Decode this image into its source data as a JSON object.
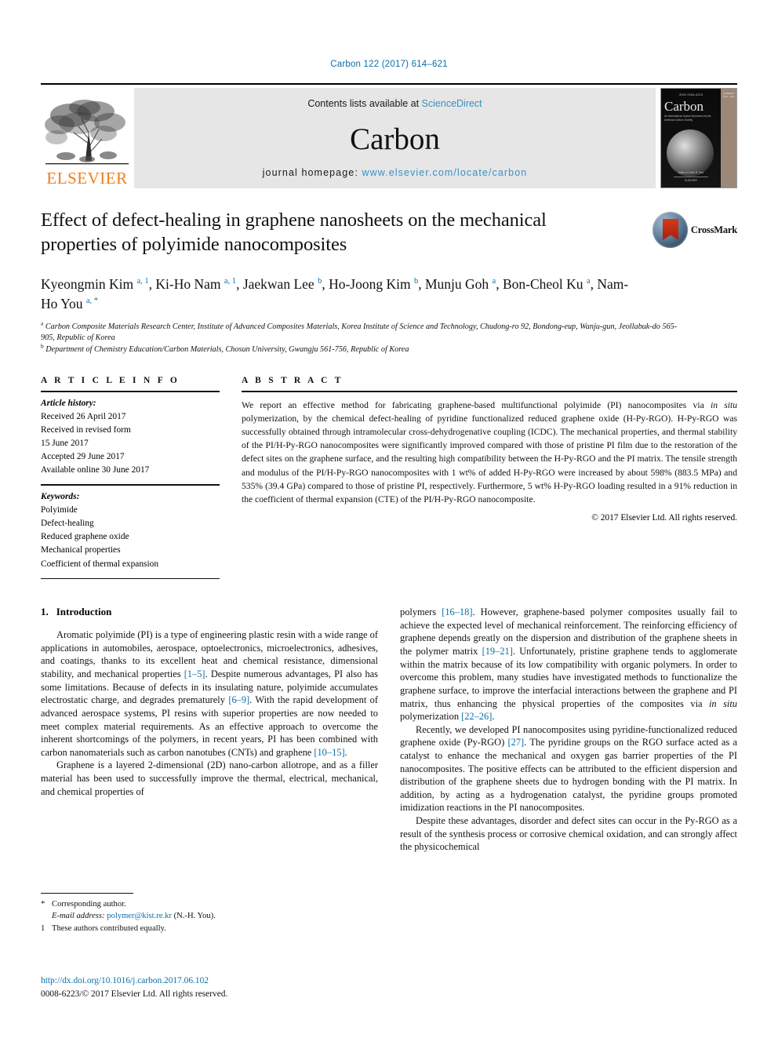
{
  "running_head": "Carbon 122 (2017) 614–621",
  "header": {
    "publisher_name": "ELSEVIER",
    "contents_prefix": "Contents lists available at ",
    "contents_link": "ScienceDirect",
    "journal_title": "Carbon",
    "homepage_prefix": "journal homepage: ",
    "homepage_url": "www.elsevier.com/locate/carbon",
    "cover": {
      "top_label": "ISSN 0008-6223",
      "word": "Carbon",
      "subtitle": "An International Journal Sponsored by the American Carbon Society",
      "spine_label": "CARBON  VOL. 122",
      "bottom_line1": "Editor-in-Chief: R. Hurt",
      "bottom_line2": "ELSEVIER"
    }
  },
  "article": {
    "title": "Effect of defect-healing in graphene nanosheets on the mechanical properties of polyimide nanocomposites",
    "crossmark_label": "CrossMark",
    "authors": [
      {
        "name": "Kyeongmin Kim",
        "sup": "a, 1",
        "sep": ", "
      },
      {
        "name": "Ki-Ho Nam",
        "sup": "a, 1",
        "sep": ", "
      },
      {
        "name": "Jaekwan Lee",
        "sup": "b",
        "sep": ", "
      },
      {
        "name": "Ho-Joong Kim",
        "sup": "b",
        "sep": ", "
      },
      {
        "name": "Munju Goh",
        "sup": "a",
        "sep": ", "
      },
      {
        "name": "Bon-Cheol Ku",
        "sup": "a",
        "sep": ", "
      },
      {
        "name": "Nam-Ho You",
        "sup": "a, *",
        "sep": ""
      }
    ],
    "affiliations": [
      {
        "mark": "a",
        "text": "Carbon Composite Materials Research Center, Institute of Advanced Composites Materials, Korea Institute of Science and Technology, Chudong-ro 92, Bondong-eup, Wanju-gun, Jeollabuk-do 565-905, Republic of Korea"
      },
      {
        "mark": "b",
        "text": "Department of Chemistry Education/Carbon Materials, Chosun University, Gwangju 561-756, Republic of Korea"
      }
    ]
  },
  "article_info": {
    "heading": "A R T I C L E  I N F O",
    "history_label": "Article history:",
    "history": [
      "Received 26 April 2017",
      "Received in revised form",
      "15 June 2017",
      "Accepted 29 June 2017",
      "Available online 30 June 2017"
    ],
    "keywords_label": "Keywords:",
    "keywords": [
      "Polyimide",
      "Defect-healing",
      "Reduced graphene oxide",
      "Mechanical properties",
      "Coefficient of thermal expansion"
    ]
  },
  "abstract": {
    "heading": "A B S T R A C T",
    "part1": "We report an effective method for fabricating graphene-based multifunctional polyimide (PI) nanocomposites via ",
    "italic1": "in situ",
    "part2": " polymerization, by the chemical defect-healing of pyridine functionalized reduced graphene oxide (H-Py-RGO). H-Py-RGO was successfully obtained through intramolecular cross-dehydrogenative coupling (ICDC). The mechanical properties, and thermal stability of the PI/H-Py-RGO nanocomposites were significantly improved compared with those of pristine PI film due to the restoration of the defect sites on the graphene surface, and the resulting high compatibility between the H-Py-RGO and the PI matrix. The tensile strength and modulus of the PI/H-Py-RGO nanocomposites with 1 wt% of added H-Py-RGO were increased by about 598% (883.5 MPa) and 535% (39.4 GPa) compared to those of pristine PI, respectively. Furthermore, 5 wt% H-Py-RGO loading resulted in a 91% reduction in the coefficient of thermal expansion (CTE) of the PI/H-Py-RGO nanocomposite.",
    "copyright": "© 2017 Elsevier Ltd. All rights reserved."
  },
  "intro": {
    "number": "1.",
    "heading": "Introduction",
    "left": {
      "p1_a": "Aromatic polyimide (PI) is a type of engineering plastic resin with a wide range of applications in automobiles, aerospace, optoelectronics, microelectronics, adhesives, and coatings, thanks to its excellent heat and chemical resistance, dimensional stability, and mechanical properties ",
      "p1_ref1": "[1–5]",
      "p1_b": ". Despite numerous advantages, PI also has some limitations. Because of defects in its insulating nature, polyimide accumulates electrostatic charge, and degrades prematurely ",
      "p1_ref2": "[6–9]",
      "p1_c": ". With the rapid development of advanced aerospace systems, PI resins with superior properties are now needed to meet complex material requirements. As an effective approach to overcome the inherent shortcomings of the polymers, in recent years, PI has been combined with carbon nanomaterials such as carbon nanotubes (CNTs) and graphene ",
      "p1_ref3": "[10–15]",
      "p1_d": ".",
      "p2_a": "Graphene is a layered 2-dimensional (2D) nano-carbon allotrope, and as a filler material has been used to successfully improve the thermal, electrical, mechanical, and chemical properties of"
    },
    "right": {
      "p2_cont_a": "polymers ",
      "p2_cont_ref": "[16–18]",
      "p2_cont_b": ". However, graphene-based polymer composites usually fail to achieve the expected level of mechanical reinforcement. The reinforcing efficiency of graphene depends greatly on the dispersion and distribution of the graphene sheets in the polymer matrix ",
      "p2_cont_ref2": "[19–21]",
      "p2_cont_c": ". Unfortunately, pristine graphene tends to agglomerate within the matrix because of its low compatibility with organic polymers. In order to overcome this problem, many studies have investigated methods to functionalize the graphene surface, to improve the interfacial interactions between the graphene and PI matrix, thus enhancing the physical properties of the composites via ",
      "p2_italic": "in situ",
      "p2_cont_d": " polymerization ",
      "p2_cont_ref3": "[22–26]",
      "p2_cont_e": ".",
      "p3_a": "Recently, we developed PI nanocomposites using pyridine-functionalized reduced graphene oxide (Py-RGO) ",
      "p3_ref": "[27]",
      "p3_b": ". The pyridine groups on the RGO surface acted as a catalyst to enhance the mechanical and oxygen gas barrier properties of the PI nanocomposites. The positive effects can be attributed to the efficient dispersion and distribution of the graphene sheets due to hydrogen bonding with the PI matrix. In addition, by acting as a hydrogenation catalyst, the pyridine groups promoted imidization reactions in the PI nanocomposites.",
      "p4": "Despite these advantages, disorder and defect sites can occur in the Py-RGO as a result of the synthesis process or corrosive chemical oxidation, and can strongly affect the physicochemical"
    }
  },
  "footnotes": {
    "corresponding_mark": "*",
    "corresponding_text": "Corresponding author.",
    "email_label": "E-mail address:",
    "email": "polymer@kist.re.kr",
    "email_suffix": "(N.-H. You).",
    "equal_mark": "1",
    "equal_text": "These authors contributed equally."
  },
  "doi_block": {
    "doi": "http://dx.doi.org/10.1016/j.carbon.2017.06.102",
    "issn": "0008-6223/© 2017 Elsevier Ltd. All rights reserved."
  },
  "colors": {
    "link": "#0b6ea8",
    "elsevier_orange": "#ef7d1a",
    "header_band": "#e6e6e6"
  }
}
